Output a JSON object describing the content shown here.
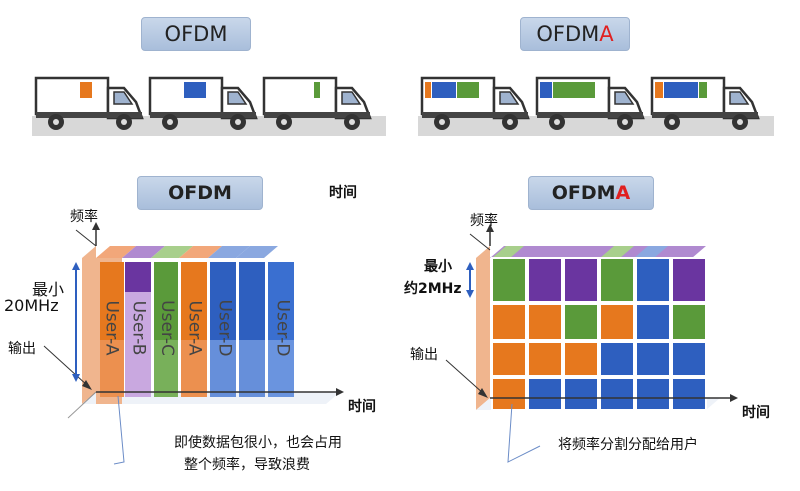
{
  "title_top_left": {
    "main": "OFDM",
    "accent": ""
  },
  "title_top_right": {
    "main": "OFDM",
    "accent": "A"
  },
  "title_mid_left": {
    "main": "OFDM",
    "accent": ""
  },
  "title_mid_right": {
    "main": "OFDM",
    "accent": "A"
  },
  "time_label_top": "时间",
  "left_chart": {
    "axis_y": "频率",
    "axis_x": "时间",
    "input_label": "输出",
    "bandwidth_line1": "最小",
    "bandwidth_line2": "20MHz",
    "users": [
      "User-A",
      "User-B",
      "User-C",
      "User-A",
      "User-D",
      "User-D"
    ],
    "caption_line1": "即使数据包很小，也会占用",
    "caption_line2": "整个频率，导致浪费"
  },
  "right_chart": {
    "axis_y": "频率",
    "axis_x": "时间",
    "input_label": "输出",
    "bandwidth_line1": "最小",
    "bandwidth_line2": "约2MHz",
    "caption": "将频率分割分配给用户"
  },
  "colors": {
    "orange": "#e6781e",
    "purple": "#6a35a0",
    "green": "#5a9a3a",
    "blue": "#2e5fbf",
    "accent_red": "#e02020"
  }
}
